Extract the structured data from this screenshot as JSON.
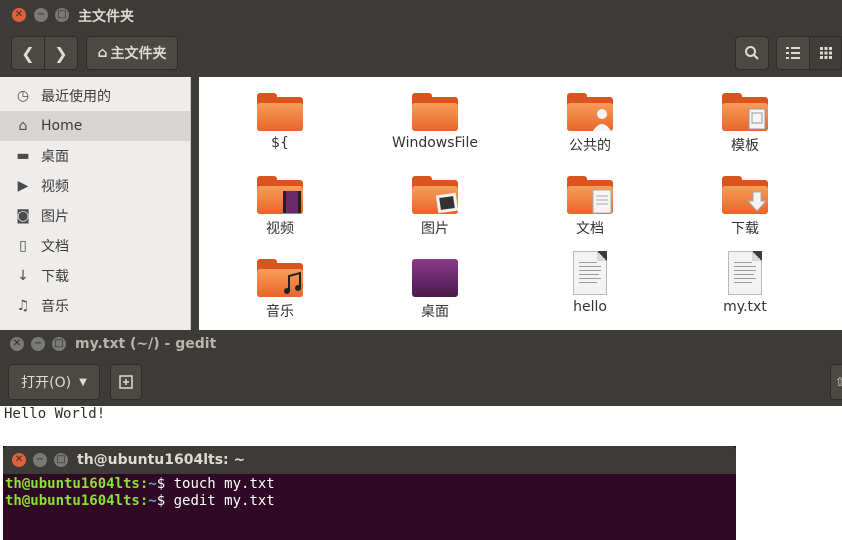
{
  "file_manager": {
    "title": "主文件夹",
    "path_button": "主文件夹",
    "sidebar": {
      "items": [
        {
          "label": "最近使用的",
          "icon": "clock-icon"
        },
        {
          "label": "Home",
          "icon": "home-icon"
        },
        {
          "label": "桌面",
          "icon": "desktop-folder-icon"
        },
        {
          "label": "视频",
          "icon": "video-icon"
        },
        {
          "label": "图片",
          "icon": "camera-icon"
        },
        {
          "label": "文档",
          "icon": "document-icon"
        },
        {
          "label": "下载",
          "icon": "download-arrow-icon"
        },
        {
          "label": "音乐",
          "icon": "music-icon"
        }
      ]
    },
    "files": [
      {
        "name": "${",
        "type": "folder"
      },
      {
        "name": "WindowsFile",
        "type": "folder"
      },
      {
        "name": "公共的",
        "type": "folder-public"
      },
      {
        "name": "模板",
        "type": "folder-templates"
      },
      {
        "name": "视频",
        "type": "folder-video"
      },
      {
        "name": "图片",
        "type": "folder-pictures"
      },
      {
        "name": "文档",
        "type": "folder-documents"
      },
      {
        "name": "下载",
        "type": "folder-download"
      },
      {
        "name": "音乐",
        "type": "folder-music"
      },
      {
        "name": "桌面",
        "type": "desktop"
      },
      {
        "name": "hello",
        "type": "text-file"
      },
      {
        "name": "my.txt",
        "type": "text-file"
      }
    ]
  },
  "gedit": {
    "title": "my.txt (~/) - gedit",
    "open_button": "打开(O)",
    "content": "Hello World!"
  },
  "terminal": {
    "title": "th@ubuntu1604lts: ~",
    "lines": [
      {
        "user_host": "th@ubuntu1604lts",
        "path": "~",
        "command": "touch my.txt"
      },
      {
        "user_host": "th@ubuntu1604lts",
        "path": "~",
        "command": "gedit my.txt"
      }
    ]
  },
  "colors": {
    "ubuntu_orange": "#e95420",
    "terminal_bg": "#300a24",
    "prompt_user": "#8ae234",
    "prompt_path": "#729fcf"
  }
}
